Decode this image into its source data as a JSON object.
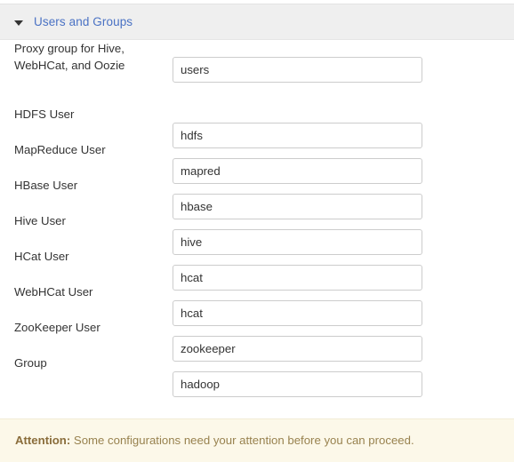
{
  "section": {
    "title": "Users and Groups",
    "caret_icon": "caret-down-icon",
    "expanded": true,
    "link_color": "#4a72c4",
    "header_bg": "#efefef"
  },
  "fields": [
    {
      "label": "Proxy group for Hive, WebHCat, and Oozie",
      "value": "users",
      "placeholder": ""
    },
    {
      "label": "HDFS User",
      "value": "hdfs",
      "placeholder": ""
    },
    {
      "label": "MapReduce User",
      "value": "mapred",
      "placeholder": ""
    },
    {
      "label": "HBase User",
      "value": "hbase",
      "placeholder": ""
    },
    {
      "label": "Hive User",
      "value": "hive",
      "placeholder": ""
    },
    {
      "label": "HCat User",
      "value": "hcat",
      "placeholder": ""
    },
    {
      "label": "WebHCat User",
      "value": "hcat",
      "placeholder": ""
    },
    {
      "label": "ZooKeeper User",
      "value": "zookeeper",
      "placeholder": ""
    },
    {
      "label": "Group",
      "value": "hadoop",
      "placeholder": ""
    }
  ],
  "alert": {
    "strong_label": "Attention:",
    "message": " Some configurations need your attention before you can proceed.",
    "bg_color": "#fcf8e9",
    "text_color": "#8a6d3b"
  }
}
